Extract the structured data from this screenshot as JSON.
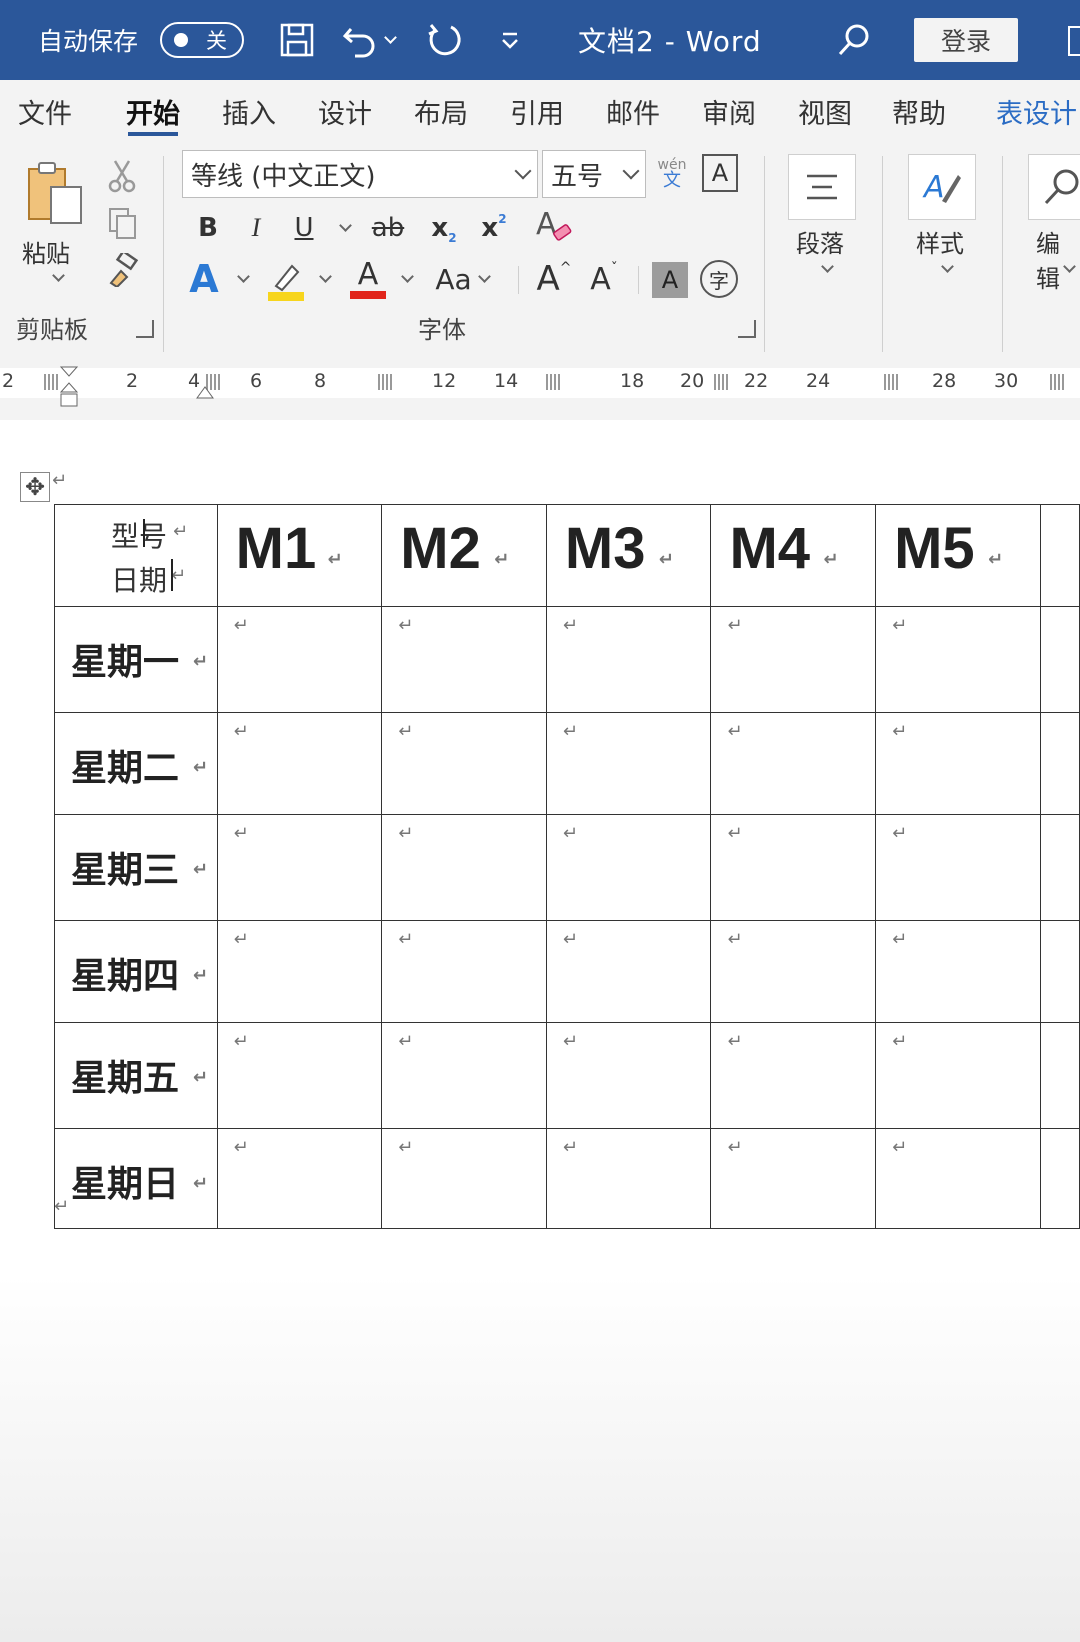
{
  "titlebar": {
    "autosave_label": "自动保存",
    "autosave_state": "关",
    "document_title": "文档2  -  Word",
    "login_label": "登录"
  },
  "tabs": [
    {
      "label": "文件"
    },
    {
      "label": "开始",
      "active": true
    },
    {
      "label": "插入"
    },
    {
      "label": "设计"
    },
    {
      "label": "布局"
    },
    {
      "label": "引用"
    },
    {
      "label": "邮件"
    },
    {
      "label": "审阅"
    },
    {
      "label": "视图"
    },
    {
      "label": "帮助"
    },
    {
      "label": "表设计"
    }
  ],
  "ribbon": {
    "clipboard": {
      "paste_label": "粘贴",
      "group_label": "剪贴板"
    },
    "font": {
      "font_name": "等线 (中文正文)",
      "font_size": "五号",
      "phonetic_top": "wén",
      "phonetic_bottom": "文",
      "char_border": "A",
      "bold": "B",
      "italic": "I",
      "underline": "U",
      "strike": "ab",
      "subscript": "x",
      "superscript": "x",
      "text_effect": "A",
      "font_color": "A",
      "change_case": "Aa",
      "grow": "A",
      "shrink": "A",
      "shading": "A",
      "enclose": "字",
      "group_label": "字体"
    },
    "paragraph_label": "段落",
    "styles_label": "样式",
    "editing_label": "编辑"
  },
  "ruler": {
    "numbers": [
      "2",
      "2",
      "4",
      "6",
      "8",
      "12",
      "14",
      "18",
      "20",
      "22",
      "24",
      "28",
      "30"
    ]
  },
  "table": {
    "corner_top": "型号",
    "corner_bottom": "日期",
    "columns": [
      "M1",
      "M2",
      "M3",
      "M4",
      "M5"
    ],
    "rows": [
      "星期一",
      "星期二",
      "星期三",
      "星期四",
      "星期五",
      "星期日"
    ]
  },
  "colors": {
    "title_bar": "#2b579a",
    "ribbon_bg": "#f3f3f3",
    "highlight": "#f7d51d",
    "font_color_bar": "#e1251b",
    "text_effect": "#2b79d4"
  }
}
